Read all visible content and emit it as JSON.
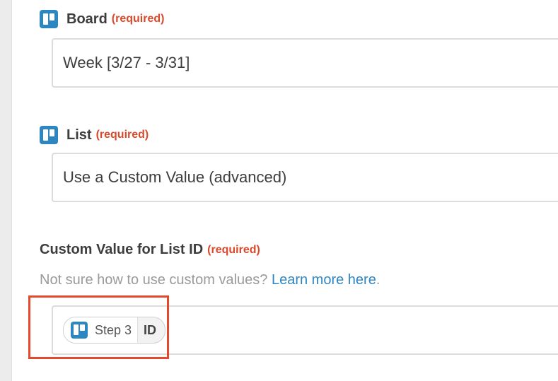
{
  "fields": {
    "board": {
      "label": "Board",
      "required": "(required)",
      "value": "Week [3/27 - 3/31]"
    },
    "list": {
      "label": "List",
      "required": "(required)",
      "value": "Use a Custom Value (advanced)"
    },
    "custom_list_id": {
      "label": "Custom Value for List ID",
      "required": "(required)",
      "help_text": "Not sure how to use custom values?",
      "help_link": "Learn more here",
      "help_suffix": ".",
      "token": {
        "step": "Step 3",
        "field": "ID"
      }
    }
  },
  "colors": {
    "trello_blue": "#2e86c1",
    "required_red": "#d94a2a",
    "highlight_red": "#e24a2b",
    "link_blue": "#2e86c1"
  },
  "icons": {
    "app_icon": "trello-icon"
  }
}
